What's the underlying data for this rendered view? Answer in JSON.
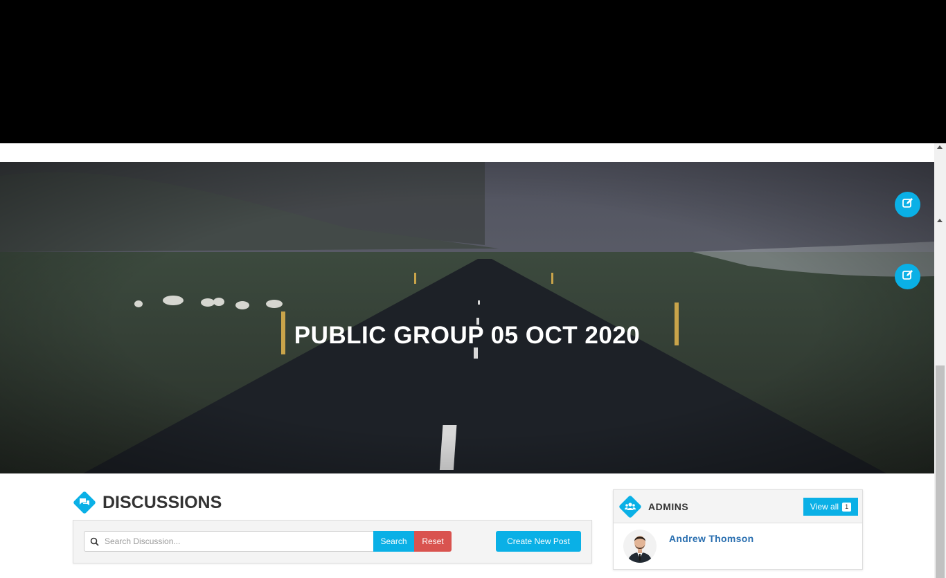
{
  "hero": {
    "title": "PUBLIC GROUP 05 OCT 2020",
    "edit_buttons": [
      "pencil-square-icon",
      "pencil-square-icon"
    ]
  },
  "discussions": {
    "title": "DISCUSSIONS",
    "search": {
      "placeholder": "Search Discussion...",
      "value": ""
    },
    "search_label": "Search",
    "reset_label": "Reset",
    "create_label": "Create New Post"
  },
  "admins": {
    "title": "ADMINS",
    "view_all_label": "View all",
    "count": "1",
    "members": [
      {
        "name": "Andrew Thomson"
      }
    ]
  },
  "colors": {
    "accent": "#0ab0e6",
    "danger": "#d9534f",
    "link": "#2a6fb0"
  }
}
